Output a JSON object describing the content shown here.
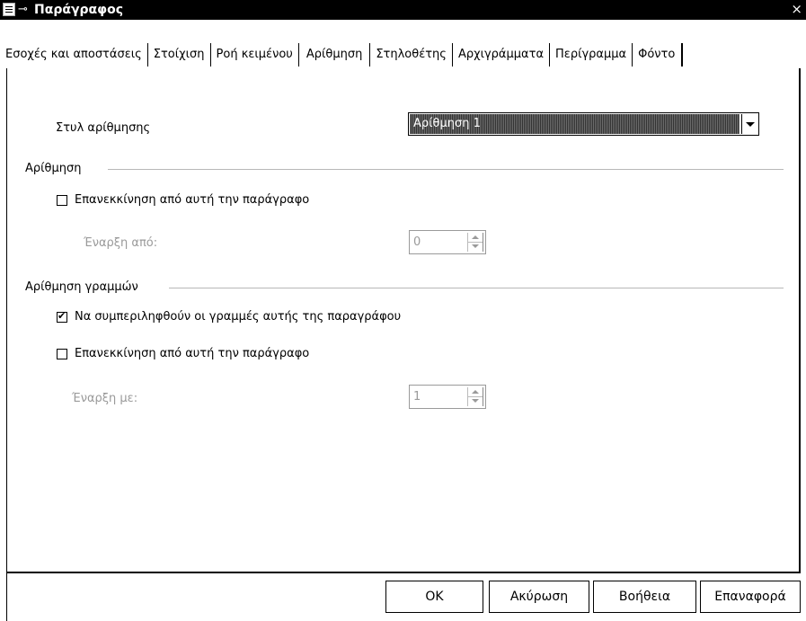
{
  "window": {
    "title": "Παράγραφος",
    "icons": {
      "app": "document-icon",
      "pin": "pin-icon",
      "close": "close-icon"
    }
  },
  "tabs": [
    {
      "label": "Εσοχές και αποστάσεις",
      "active": false
    },
    {
      "label": "Στοίχιση",
      "active": false
    },
    {
      "label": "Ροή κειμένου",
      "active": false
    },
    {
      "label": "Αρίθμηση",
      "active": true
    },
    {
      "label": "Στηλοθέτης",
      "active": false
    },
    {
      "label": "Αρχιγράμματα",
      "active": false
    },
    {
      "label": "Περίγραμμα",
      "active": false
    },
    {
      "label": "Φόντο",
      "active": false
    }
  ],
  "numbering_style": {
    "label": "Στυλ αρίθμησης",
    "selected": "Αρίθμηση 1"
  },
  "numbering_group": {
    "title": "Αρίθμηση",
    "restart_checkbox": {
      "label": "Επανεκκίνηση από αυτή την παράγραφο",
      "checked": false
    },
    "start_label": "Έναρξη από:",
    "start_value": "0"
  },
  "line_numbering_group": {
    "title": "Αρίθμηση γραμμών",
    "include_checkbox": {
      "label": "Να συμπεριληφθούν οι γραμμές αυτής της παραγράφου",
      "checked": true
    },
    "restart_checkbox": {
      "label": "Επανεκκίνηση από αυτή την παράγραφο",
      "checked": false
    },
    "start_label": "Έναρξη με:",
    "start_value": "1"
  },
  "buttons": {
    "ok": "OK",
    "cancel": "Ακύρωση",
    "help": "Βοήθεια",
    "reset": "Επαναφορά"
  }
}
